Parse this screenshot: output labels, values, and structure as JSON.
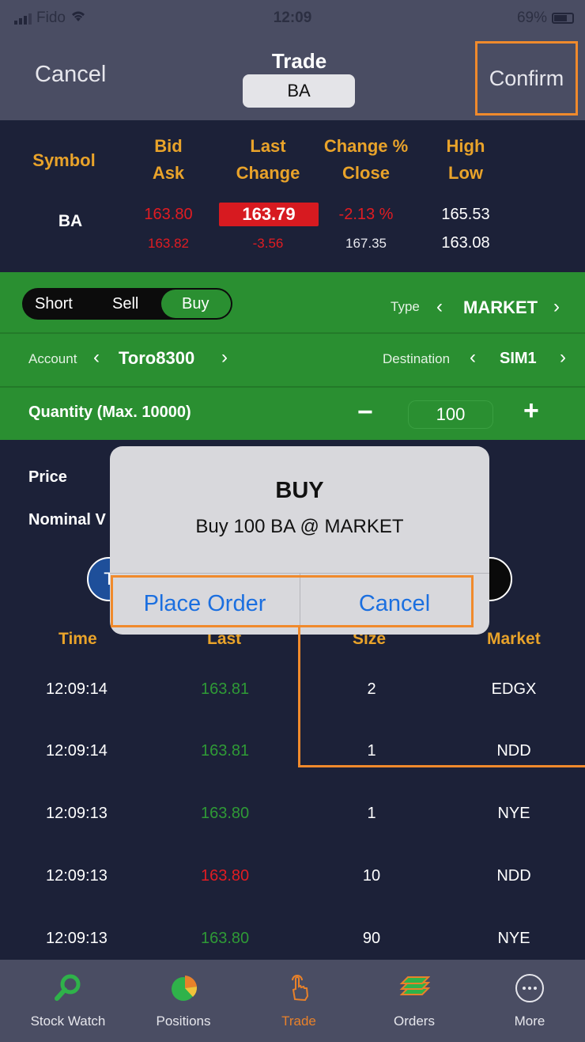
{
  "status": {
    "carrier": "Fido",
    "time": "12:09",
    "battery": "69%"
  },
  "nav": {
    "cancel": "Cancel",
    "title": "Trade",
    "symbol": "BA",
    "confirm": "Confirm"
  },
  "quote": {
    "headers": {
      "symbol": "Symbol",
      "bid": "Bid",
      "ask": "Ask",
      "last": "Last",
      "change": "Change",
      "change_pct": "Change %",
      "close": "Close",
      "high": "High",
      "low": "Low"
    },
    "symbol": "BA",
    "bid": "163.80",
    "ask": "163.82",
    "last": "163.79",
    "change": "-3.56",
    "change_pct": "-2.13 %",
    "close": "167.35",
    "high": "165.53",
    "low": "163.08"
  },
  "order": {
    "side_options": [
      "Short",
      "Sell",
      "Buy"
    ],
    "type_label": "Type",
    "type_value": "MARKET",
    "account_label": "Account",
    "account_value": "Toro8300",
    "destination_label": "Destination",
    "destination_value": "SIM1",
    "quantity_label": "Quantity (Max. 10000)",
    "quantity_value": "100",
    "minus": "−",
    "plus": "+"
  },
  "details": {
    "price_label": "Price",
    "nominal_label": "Nominal V",
    "toggle_letter": "T"
  },
  "trades": {
    "headers": {
      "time": "Time",
      "last": "Last",
      "size": "Size",
      "market": "Market"
    },
    "rows": [
      {
        "time": "12:09:14",
        "last": "163.81",
        "size": "2",
        "market": "EDGX",
        "color": "#2f9a36"
      },
      {
        "time": "12:09:14",
        "last": "163.81",
        "size": "1",
        "market": "NDD",
        "color": "#2f9a36"
      },
      {
        "time": "12:09:13",
        "last": "163.80",
        "size": "1",
        "market": "NYE",
        "color": "#2f9a36"
      },
      {
        "time": "12:09:13",
        "last": "163.80",
        "size": "10",
        "market": "NDD",
        "color": "#e11c22"
      },
      {
        "time": "12:09:13",
        "last": "163.80",
        "size": "90",
        "market": "NYE",
        "color": "#2f9a36"
      }
    ]
  },
  "alert": {
    "title": "BUY",
    "message": "Buy 100 BA @ MARKET",
    "place_order": "Place Order",
    "cancel": "Cancel"
  },
  "tabs": [
    {
      "label": "Stock Watch",
      "icon": "magnifier-icon",
      "active": false
    },
    {
      "label": "Positions",
      "icon": "pie-chart-icon",
      "active": false
    },
    {
      "label": "Trade",
      "icon": "tap-hand-icon",
      "active": true
    },
    {
      "label": "Orders",
      "icon": "stack-icon",
      "active": false
    },
    {
      "label": "More",
      "icon": "ellipsis-circle-icon",
      "active": false
    }
  ],
  "colors": {
    "accent": "#e9a32a",
    "panel_green": "#2a8f31",
    "down_red": "#e11c22",
    "up_green": "#2f9a36",
    "highlight_orange": "#f08a2c",
    "link_blue": "#1b6fe0"
  }
}
